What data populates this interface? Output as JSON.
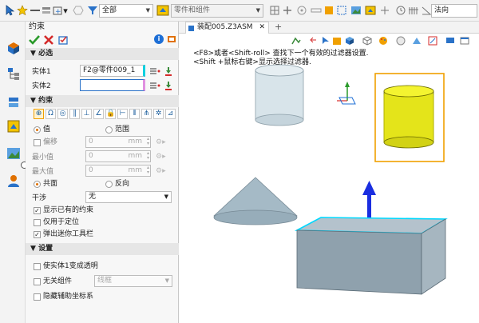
{
  "toolbar": {
    "filter_value": "全部",
    "component_filter": "零件和组件",
    "normal_value": "法向"
  },
  "panel": {
    "title": "约束",
    "required_section": "必选",
    "entity1_label": "实体1",
    "entity1_value": "F2@零件009_1",
    "entity2_label": "实体2",
    "entity2_value": "",
    "constraint_section": "约束",
    "value_radio": "值",
    "range_radio": "范围",
    "offset_label": "偏移",
    "offset_value": "0",
    "min_label": "最小值",
    "min_value": "0",
    "max_label": "最大值",
    "max_value": "0",
    "unit": "mm",
    "coplanar_radio": "共面",
    "reverse_radio": "反向",
    "interference_label": "干涉",
    "interference_value": "无",
    "show_existing": "显示已有的约束",
    "locate_only": "仅用于定位",
    "popup_toolbar": "弹出迷你工具栏",
    "settings_section": "设置",
    "transparent": "使实体1变成透明",
    "irrelevant": "无关组件",
    "wireframe": "线框",
    "hide_aux": "隐藏辅助坐标系",
    "help_label": "?"
  },
  "tab": {
    "label": "装配005.Z3ASM",
    "close": "✕",
    "add": "+"
  },
  "viewport": {
    "hint1": "<F8>或者<Shift-roll> 查找下一个有效的过滤器设置.",
    "hint2": "<Shift +鼠标右键>显示选择过滤器."
  },
  "colors": {
    "accent": "#1e6fd6",
    "selection_yellow": "#e8e81a",
    "highlight_cyan": "#00d8ff",
    "frame_orange": "#f0a000",
    "solid_gray": "#a8b8c4"
  }
}
